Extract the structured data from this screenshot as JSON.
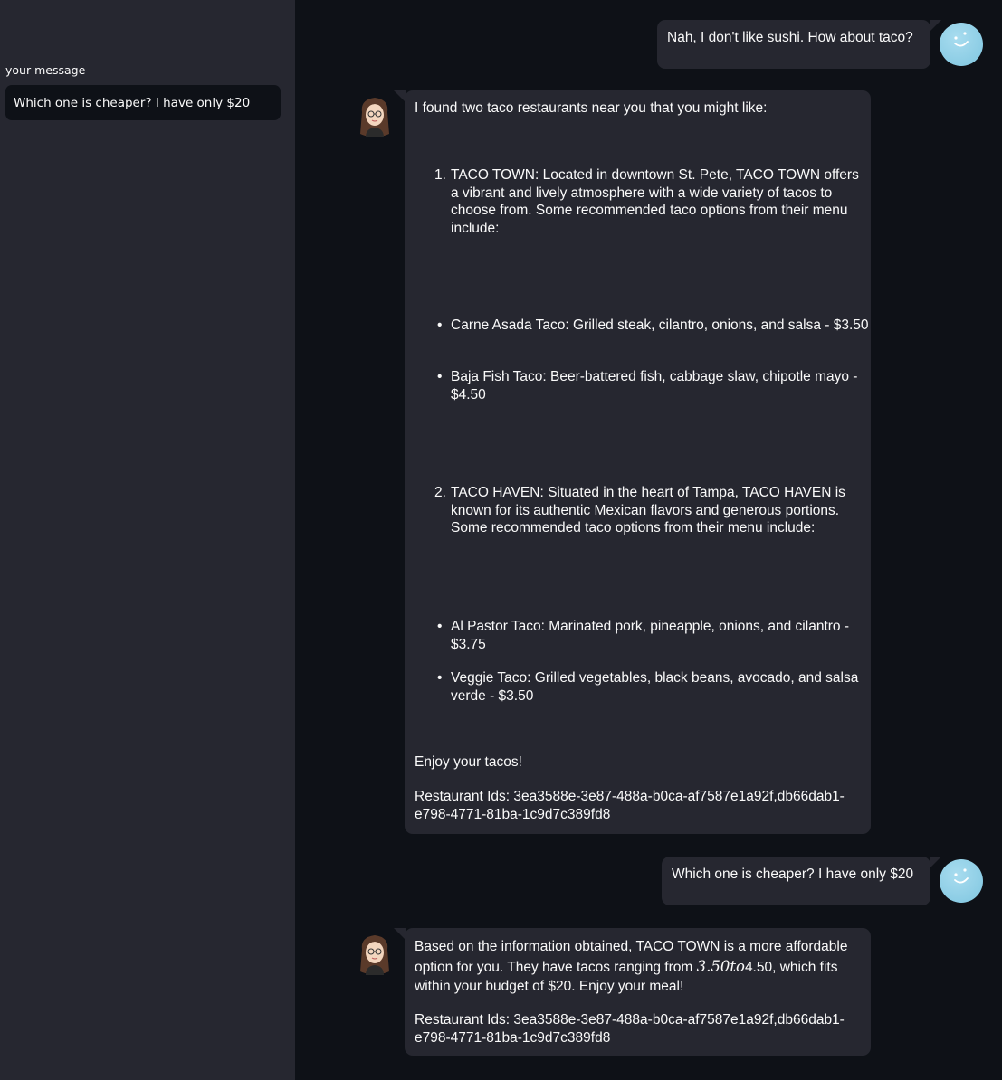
{
  "sidebar": {
    "label": "your message",
    "input_value": "Which one is cheaper? I have only $20"
  },
  "avatars": {
    "user": "smiley-face-avatar-icon",
    "bot": "woman-with-glasses-avatar-icon"
  },
  "colors": {
    "background": "#0e1117",
    "sidebar": "#262730",
    "bubble": "#262730",
    "text": "#fafafa",
    "user_avatar": "#87ceeb"
  },
  "chat": {
    "msg1": {
      "text": "Nah, I don't like sushi. How about taco?"
    },
    "msg2": {
      "intro": "I found two taco restaurants near you that you might like:",
      "item1_num": "1.",
      "item1": "TACO TOWN: Located in downtown St. Pete, TACO TOWN offers a vibrant and lively atmosphere with a wide variety of tacos to choose from. Some recommended taco options from their menu include:",
      "item1_bullet1": "Carne Asada Taco: Grilled steak, cilantro, onions, and salsa - $3.50",
      "item1_bullet2": "Baja Fish Taco: Beer-battered fish, cabbage slaw, chipotle mayo - $4.50",
      "item2_num": "2.",
      "item2": "TACO HAVEN: Situated in the heart of Tampa, TACO HAVEN is known for its authentic Mexican flavors and generous portions. Some recommended taco options from their menu include:",
      "item2_bullet1": "Al Pastor Taco: Marinated pork, pineapple, onions, and cilantro - $3.75",
      "item2_bullet2": "Veggie Taco: Grilled vegetables, black beans, avocado, and salsa verde - $3.50",
      "outro": "Enjoy your tacos!",
      "ids": "Restaurant Ids: 3ea3588e-3e87-488a-b0ca-af7587e1a92f,db66dab1-e798-4771-81ba-1c9d7c389fd8"
    },
    "msg3": {
      "text": "Which one is cheaper? I have only $20"
    },
    "msg4": {
      "text_a": "Based on the information obtained, TACO TOWN is a more affordable option for you. They have tacos ranging from ",
      "math": "3.50to",
      "text_b": "4.50, which fits within your budget of $20. Enjoy your meal!",
      "ids": "Restaurant Ids: 3ea3588e-3e87-488a-b0ca-af7587e1a92f,db66dab1-e798-4771-81ba-1c9d7c389fd8"
    }
  }
}
